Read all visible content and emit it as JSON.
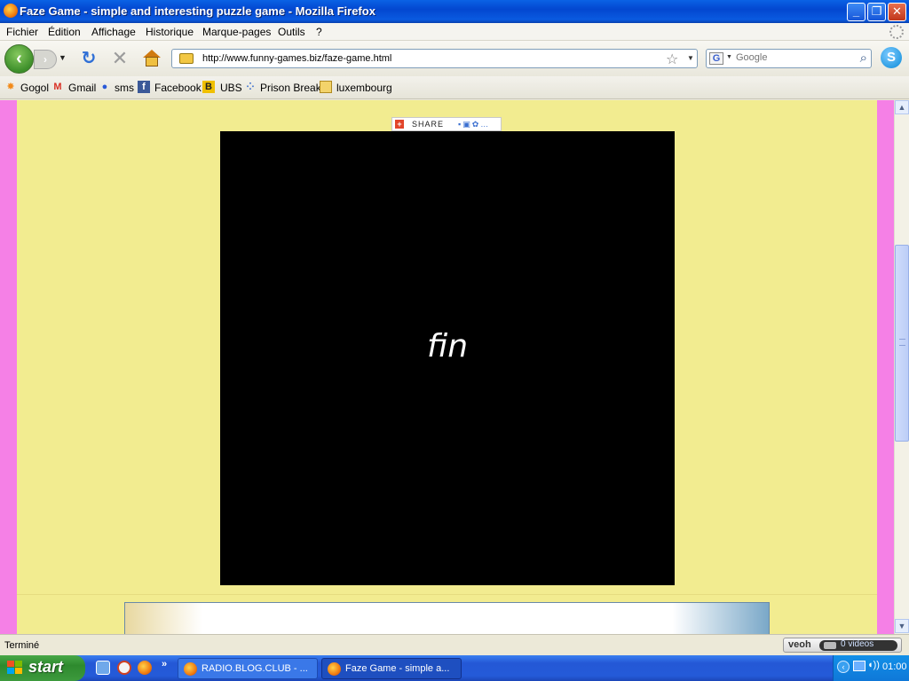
{
  "window": {
    "title": "Faze Game - simple and interesting puzzle game - Mozilla Firefox",
    "buttons": {
      "minimize": "_",
      "restore": "❐",
      "close": "✕"
    }
  },
  "menubar": {
    "items": [
      "Fichier",
      "Édition",
      "Affichage",
      "Historique",
      "Marque-pages",
      "Outils",
      "?"
    ]
  },
  "navbar": {
    "url": "http://www.funny-games.biz/faze-game.html",
    "search_placeholder": "Google",
    "search_engine_letter": "G"
  },
  "bookmarks": {
    "items": [
      "Gogol",
      "Gmail",
      "sms",
      "Facebook",
      "UBS",
      "Prison Break",
      "luxembourg"
    ]
  },
  "content": {
    "share_label": "SHARE",
    "game_text": "fin",
    "background_color": "#f2ec90",
    "side_color": "#f580e6"
  },
  "statusbar": {
    "status": "Terminé",
    "veoh_logo": "veoh",
    "veoh_count": "0  videos"
  },
  "taskbar": {
    "start_label": "start",
    "tasks": [
      "RADIO.BLOG.CLUB - ...",
      "Faze Game - simple a..."
    ],
    "clock": "01:00"
  }
}
